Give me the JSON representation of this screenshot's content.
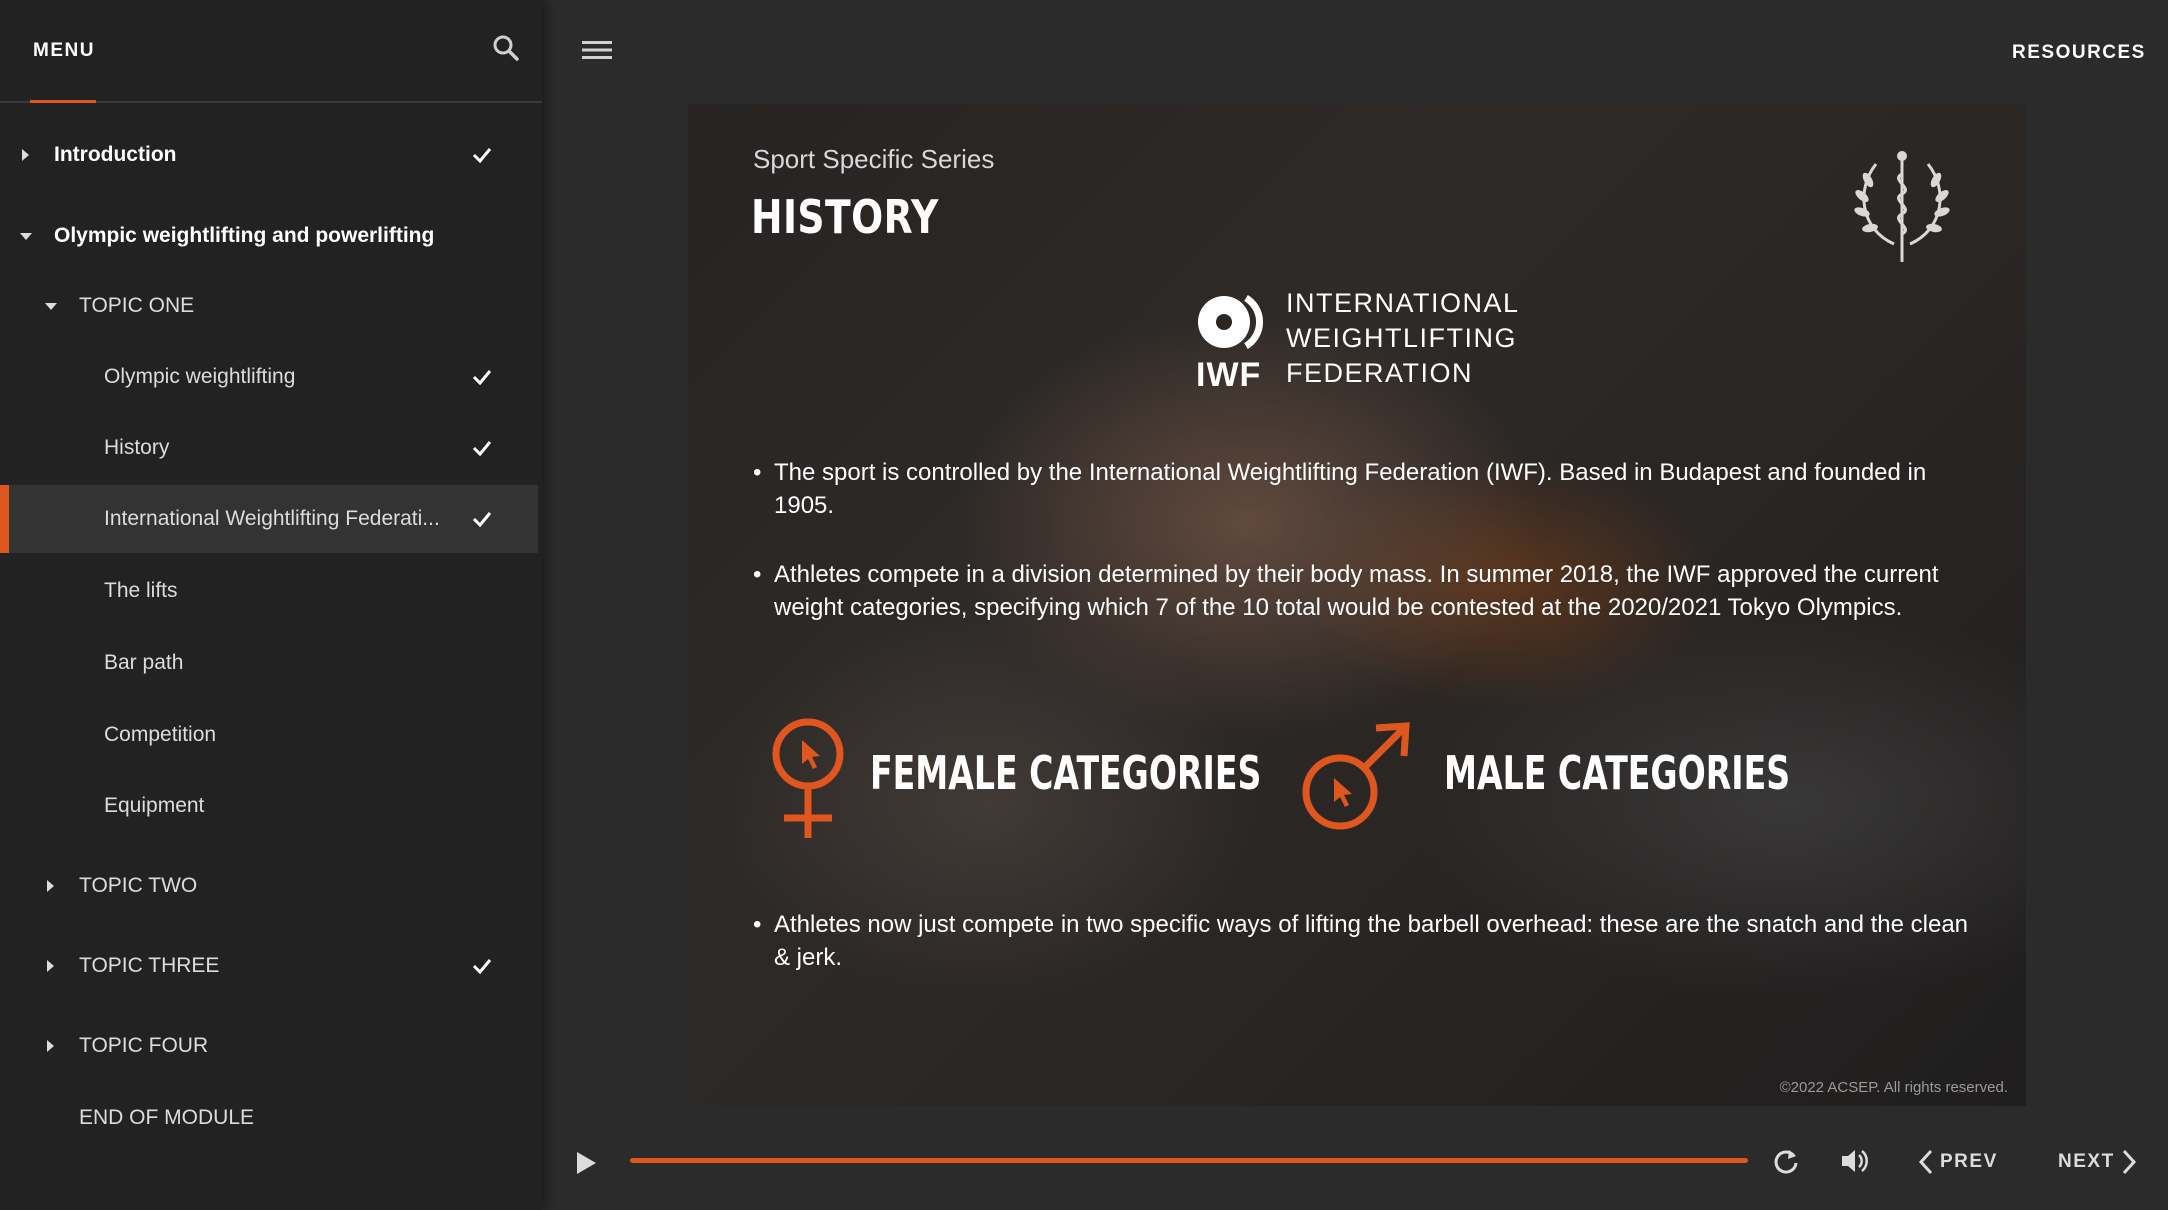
{
  "sidebar": {
    "title": "MENU",
    "items": [
      {
        "label": "Introduction",
        "completed": true
      },
      {
        "label": "Olympic weightlifting and powerlifting",
        "completed": false
      },
      {
        "label": "TOPIC ONE",
        "completed": false
      },
      {
        "label": "Olympic weightlifting",
        "completed": true
      },
      {
        "label": "History",
        "completed": true
      },
      {
        "label": "International Weightlifting Federati...",
        "completed": true,
        "active": true
      },
      {
        "label": "The lifts",
        "completed": false
      },
      {
        "label": "Bar path",
        "completed": false
      },
      {
        "label": "Competition",
        "completed": false
      },
      {
        "label": "Equipment",
        "completed": false
      },
      {
        "label": "TOPIC TWO",
        "completed": false
      },
      {
        "label": "TOPIC THREE",
        "completed": true
      },
      {
        "label": "TOPIC FOUR",
        "completed": false
      },
      {
        "label": "END OF MODULE",
        "completed": false
      }
    ]
  },
  "header": {
    "resources_label": "RESOURCES"
  },
  "slide": {
    "series": "Sport Specific Series",
    "title": "HISTORY",
    "logo": {
      "abbr": "IWF",
      "line1": "INTERNATIONAL",
      "line2": "WEIGHTLIFTING",
      "line3": "FEDERATION"
    },
    "bullets": [
      "The sport is controlled by the International Weightlifting Federation (IWF). Based in Budapest and founded in 1905.",
      "Athletes compete in a division determined by their body mass. In summer 2018, the IWF approved the current weight categories, specifying which 7 of the 10 total would be contested at the 2020/2021 Tokyo Olympics.",
      "Athletes now just compete in two specific ways of lifting the barbell overhead: these are the snatch and the clean & jerk."
    ],
    "female_label": "FEMALE CATEGORIES",
    "male_label": "MALE CATEGORIES",
    "copyright": "©2022 ACSEP. All rights reserved."
  },
  "player": {
    "progress": 1.0,
    "prev_label": "PREV",
    "next_label": "NEXT"
  },
  "colors": {
    "accent": "#e0561f",
    "sidebar_bg": "#222222",
    "main_bg": "#2b2b2b"
  }
}
